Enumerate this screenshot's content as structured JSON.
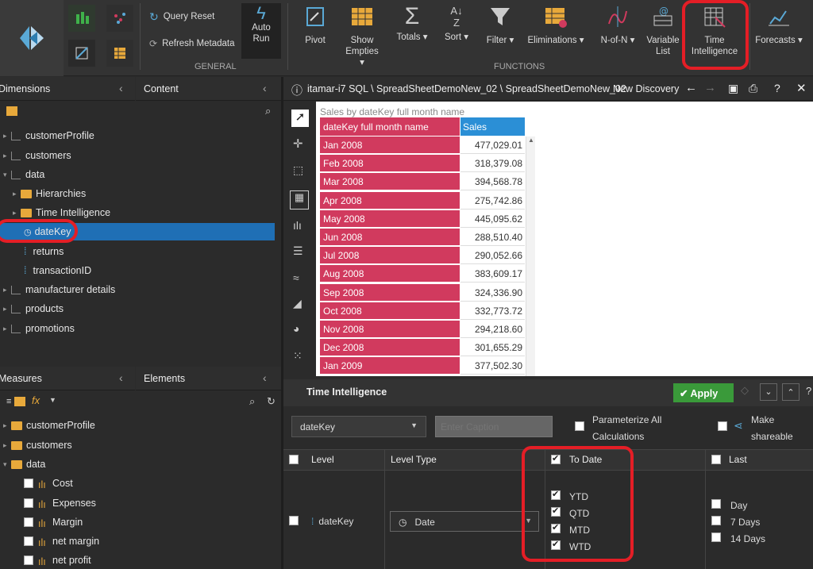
{
  "ribbon": {
    "general": {
      "query_reset": "Query Reset",
      "refresh_metadata": "Refresh Metadata",
      "auto_run": "Auto Run",
      "group_label": "GENERAL"
    },
    "functions": {
      "pivot": "Pivot",
      "show_empties": "Show Empties ▾",
      "totals": "Totals ▾",
      "sort": "Sort ▾",
      "filter": "Filter ▾",
      "eliminations": "Eliminations ▾",
      "n_of_n": "N-of-N ▾",
      "variable_list": "Variable List",
      "time_intelligence": "Time Intelligence",
      "forecasts": "Forecasts ▾",
      "group_label": "FUNCTIONS"
    }
  },
  "dimensions_panel": {
    "title": "Dimensions",
    "content_tab": "Content",
    "items": [
      {
        "label": "customerProfile"
      },
      {
        "label": "customers"
      },
      {
        "label": "data"
      },
      {
        "label": "Hierarchies"
      },
      {
        "label": "Time Intelligence"
      },
      {
        "label": "dateKey"
      },
      {
        "label": "returns"
      },
      {
        "label": "transactionID"
      },
      {
        "label": "manufacturer details"
      },
      {
        "label": "products"
      },
      {
        "label": "promotions"
      }
    ]
  },
  "measures_panel": {
    "title": "Measures",
    "elements_tab": "Elements",
    "items": [
      {
        "label": "customerProfile"
      },
      {
        "label": "customers"
      },
      {
        "label": "data"
      },
      {
        "label": "Cost"
      },
      {
        "label": "Expenses"
      },
      {
        "label": "Margin"
      },
      {
        "label": "net margin"
      },
      {
        "label": "net profit"
      }
    ]
  },
  "breadcrumb": "itamar-i7 SQL \\ SpreadSheetDemoNew_02 \\ SpreadSheetDemoNew_02",
  "discovery_label": "New Discovery",
  "grid": {
    "title": "Sales by dateKey full month name",
    "col1": "dateKey full month name",
    "col2": "Sales",
    "rows": [
      {
        "month": "Jan 2008",
        "sales": "477,029.01"
      },
      {
        "month": "Feb 2008",
        "sales": "318,379.08"
      },
      {
        "month": "Mar 2008",
        "sales": "394,568.78"
      },
      {
        "month": "Apr 2008",
        "sales": "275,742.86"
      },
      {
        "month": "May 2008",
        "sales": "445,095.62"
      },
      {
        "month": "Jun 2008",
        "sales": "288,510.40"
      },
      {
        "month": "Jul 2008",
        "sales": "290,052.66"
      },
      {
        "month": "Aug 2008",
        "sales": "383,609.17"
      },
      {
        "month": "Sep 2008",
        "sales": "324,336.90"
      },
      {
        "month": "Oct 2008",
        "sales": "332,773.72"
      },
      {
        "month": "Nov 2008",
        "sales": "294,218.60"
      },
      {
        "month": "Dec 2008",
        "sales": "301,655.29"
      },
      {
        "month": "Jan 2009",
        "sales": "377,502.30"
      }
    ]
  },
  "ti_panel": {
    "title": "Time Intelligence",
    "apply": "Apply",
    "dimension_select": "dateKey",
    "caption_placeholder": "Enter Caption",
    "parameterize": "Parameterize All Calculations",
    "make_shareable": "Make shareable",
    "col_level": "Level",
    "col_level_type": "Level Type",
    "col_to_date": "To Date",
    "col_last": "Last",
    "row_level": "dateKey",
    "row_level_type": "Date",
    "to_date_options": [
      "YTD",
      "QTD",
      "MTD",
      "WTD"
    ],
    "last_options": [
      "Day",
      "7 Days",
      "14 Days"
    ]
  },
  "colors": {
    "accent_red": "#d13a5e",
    "apply_green": "#3a9a3a",
    "highlight_blue": "#1f6fb5",
    "annotation_red": "#e41e26"
  }
}
